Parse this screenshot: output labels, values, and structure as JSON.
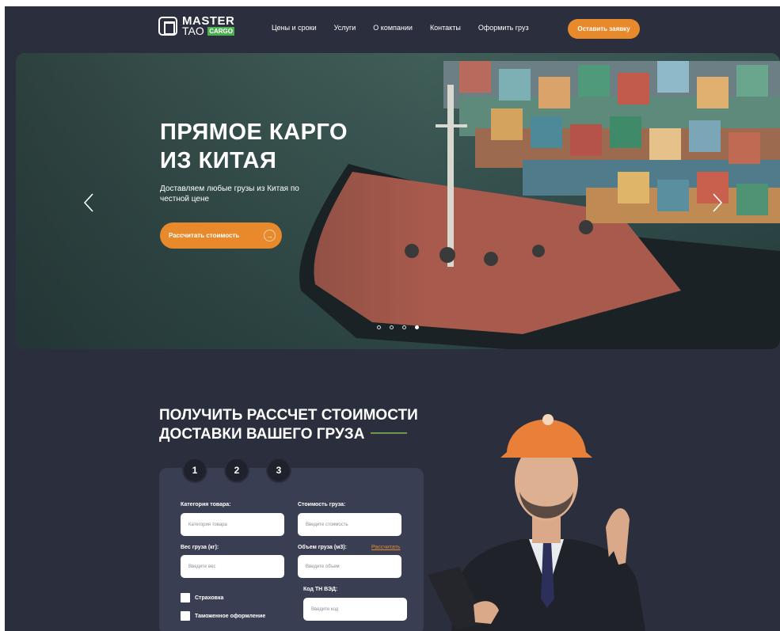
{
  "header": {
    "logo_top": "MASTER",
    "logo_tao": "TAO",
    "logo_cargo": "CARGO",
    "nav": [
      "Цены и сроки",
      "Услуги",
      "О компании",
      "Контакты",
      "Оформить груз"
    ],
    "cta": "Оставить заявку"
  },
  "hero": {
    "title_line1": "ПРЯМОЕ КАРГО",
    "title_line2": "ИЗ КИТАЯ",
    "subtitle": "Доставляем любые грузы из Китая по честной цене",
    "button": "Рассчитать стоимость",
    "slides_total": 4,
    "active_slide": 4
  },
  "calc": {
    "title_line1": "ПОЛУЧИТЬ РАССЧЕТ СТОИМОСТИ",
    "title_line2": "ДОСТАВКИ ВАШЕГО ГРУЗА",
    "steps": [
      "1",
      "2",
      "3"
    ],
    "category_label": "Категория товара:",
    "category_placeholder": "Категория товара",
    "cost_label": "Стоимость груза:",
    "cost_placeholder": "Введите стоимость",
    "weight_label": "Вес груза (кг):",
    "weight_placeholder": "Введите вес",
    "volume_label": "Объем груза (м3):",
    "volume_link": "Рассчитать",
    "volume_placeholder": "Введите объем",
    "tnved_label": "Код ТН ВЭД:",
    "tnved_placeholder": "Введите код",
    "insurance_label": "Страховка",
    "customs_label": "Таможенное оформление"
  },
  "colors": {
    "background": "#2b2e3c",
    "accent": "#e8892c",
    "card": "#3a3e52",
    "green": "#4caf50"
  }
}
